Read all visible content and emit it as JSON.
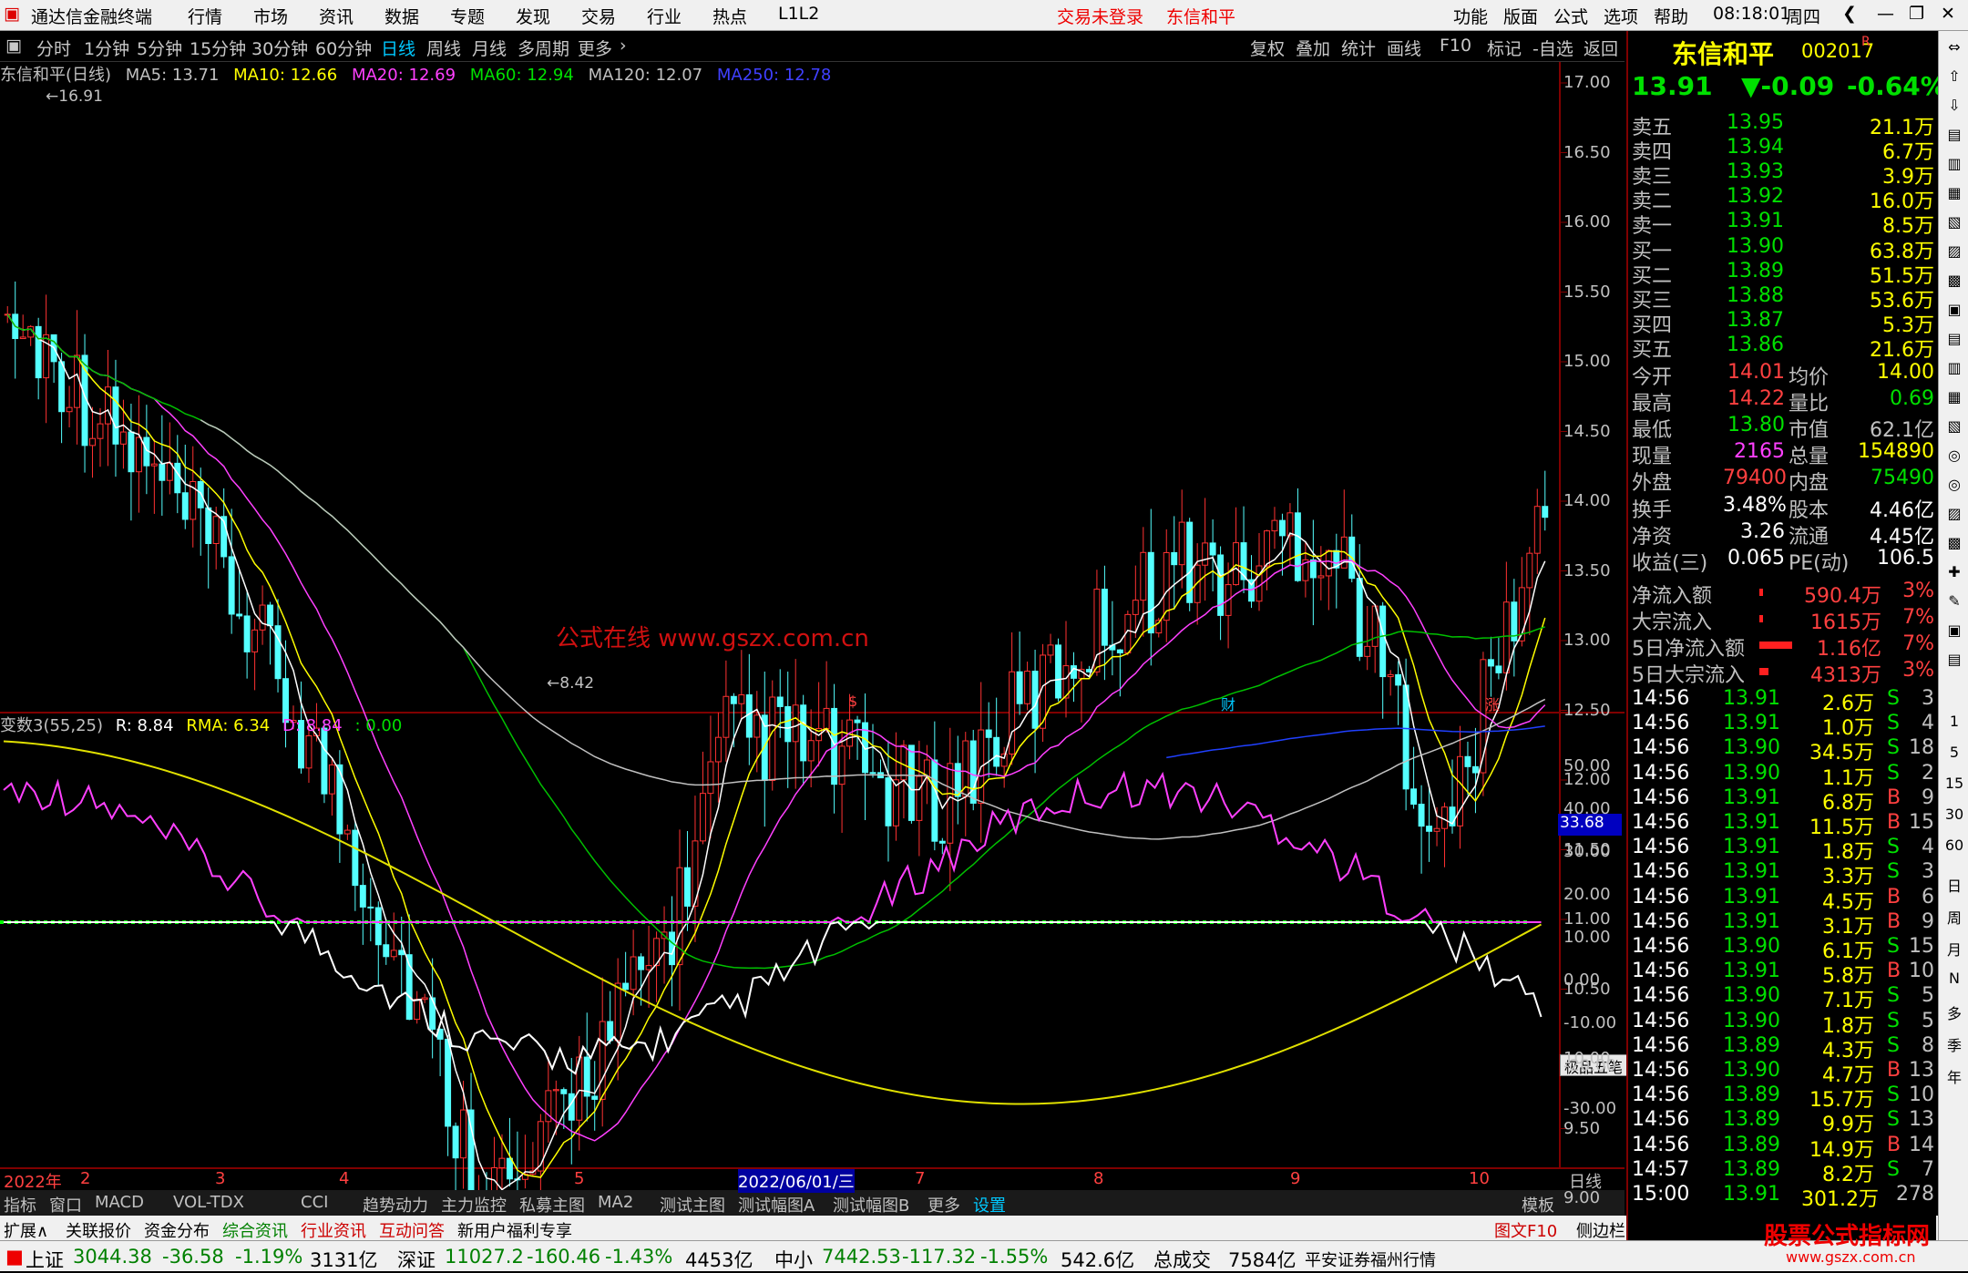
{
  "app": {
    "title": "通达信金融终端",
    "time": "08:18:01",
    "weekday": "周四",
    "login_status": "交易未登录",
    "stock_title": "东信和平"
  },
  "menu": [
    "行情",
    "市场",
    "资讯",
    "数据",
    "专题",
    "发现",
    "交易",
    "行业",
    "热点",
    "L1L2"
  ],
  "right_menu": [
    "功能",
    "版面",
    "公式",
    "选项",
    "帮助"
  ],
  "periods": [
    "分时",
    "1分钟",
    "5分钟",
    "15分钟",
    "30分钟",
    "60分钟",
    "日线",
    "周线",
    "月线",
    "多周期",
    "更多"
  ],
  "tools": [
    "复权",
    "叠加",
    "统计",
    "画线",
    "F10",
    "标记",
    "-自选",
    "返回"
  ],
  "chart": {
    "name": "东信和平(日线)",
    "ma5": "MA5: 13.71",
    "ma10": "MA10: 12.66",
    "ma20": "MA20: 12.69",
    "ma60": "MA60: 12.94",
    "ma120": "MA120: 12.07",
    "ma250": "MA250: 12.78",
    "high_label": "16.91",
    "low_label": "8.42",
    "watermark": "公式在线 www.gszx.com.cn",
    "events": [
      "$",
      "财",
      "涨"
    ]
  },
  "price_axis": [
    "17.00",
    "16.50",
    "16.00",
    "15.50",
    "15.00",
    "14.50",
    "14.00",
    "13.50",
    "13.00",
    "12.50",
    "12.00",
    "11.50",
    "11.00",
    "10.50",
    "10.00",
    "9.50",
    "9.00"
  ],
  "indicator": {
    "name": "变数3(55,25)",
    "r": "R: 8.84",
    "rma": "RMA: 6.34",
    "d": "D: 8.84",
    "zero": ": 0.00",
    "current": "33.68",
    "button": "极品五笔"
  },
  "ind_axis": [
    "50.00",
    "40.00",
    "30.00",
    "20.00",
    "10.00",
    "0.00",
    "-10.00",
    "-20.00",
    "-30.00"
  ],
  "date_axis": [
    "2022年",
    "2",
    "3",
    "4",
    "5",
    "2022/06/01/三",
    "7",
    "8",
    "9",
    "10",
    "日线"
  ],
  "tabs": [
    "指标",
    "窗口",
    "MACD",
    "VOL-TDX",
    "CCI",
    "趋势动力",
    "主力监控",
    "私募主图",
    "MA2",
    "测试主图",
    "测试幅图A",
    "测试幅图B",
    "更多",
    "设置",
    "模板"
  ],
  "tabs2": [
    "扩展∧",
    "关联报价",
    "资金分布",
    "综合资讯",
    "行业资讯",
    "互动问答",
    "新用户福利专享"
  ],
  "tabs2_right": [
    "图文F10",
    "侧边栏 ≪",
    "笔",
    "价",
    "细",
    "势",
    "联",
    "值"
  ],
  "quote": {
    "name": "东信和平",
    "code": "002017",
    "price": "13.91",
    "change": "▼-0.09",
    "pct": "-0.64%",
    "sells": [
      [
        "卖五",
        "13.95",
        "21.1万"
      ],
      [
        "卖四",
        "13.94",
        "6.7万"
      ],
      [
        "卖三",
        "13.93",
        "3.9万"
      ],
      [
        "卖二",
        "13.92",
        "16.0万"
      ],
      [
        "卖一",
        "13.91",
        "8.5万"
      ]
    ],
    "buys": [
      [
        "买一",
        "13.90",
        "63.8万"
      ],
      [
        "买二",
        "13.89",
        "51.5万"
      ],
      [
        "买三",
        "13.88",
        "53.6万"
      ],
      [
        "买四",
        "13.87",
        "5.3万"
      ],
      [
        "买五",
        "13.86",
        "21.6万"
      ]
    ],
    "stats": [
      [
        "今开",
        "14.01",
        "均价",
        "14.00"
      ],
      [
        "最高",
        "14.22",
        "量比",
        "0.69"
      ],
      [
        "最低",
        "13.80",
        "市值",
        "62.1亿"
      ],
      [
        "现量",
        "2165",
        "总量",
        "154890"
      ],
      [
        "外盘",
        "79400",
        "内盘",
        "75490"
      ]
    ],
    "stats2": [
      [
        "换手",
        "3.48%",
        "股本",
        "4.46亿"
      ],
      [
        "净资",
        "3.26",
        "流通",
        "4.45亿"
      ],
      [
        "收益(三)",
        "0.065",
        "PE(动)",
        "106.5"
      ]
    ],
    "flows": [
      [
        "净流入额",
        "590.4万",
        "3%"
      ],
      [
        "大宗流入",
        "1615万",
        "7%"
      ],
      [
        "5日净流入额",
        "1.16亿",
        "7%"
      ],
      [
        "5日大宗流入",
        "4313万",
        "3%"
      ]
    ],
    "ticks": [
      [
        "14:56",
        "13.91",
        "2.6万",
        "S",
        "3"
      ],
      [
        "14:56",
        "13.91",
        "1.0万",
        "S",
        "4"
      ],
      [
        "14:56",
        "13.90",
        "34.5万",
        "S",
        "18"
      ],
      [
        "14:56",
        "13.90",
        "1.1万",
        "S",
        "2"
      ],
      [
        "14:56",
        "13.91",
        "6.8万",
        "B",
        "9"
      ],
      [
        "14:56",
        "13.91",
        "11.5万",
        "B",
        "15"
      ],
      [
        "14:56",
        "13.91",
        "1.8万",
        "S",
        "4"
      ],
      [
        "14:56",
        "13.91",
        "3.3万",
        "S",
        "3"
      ],
      [
        "14:56",
        "13.91",
        "4.5万",
        "B",
        "6"
      ],
      [
        "14:56",
        "13.91",
        "3.1万",
        "B",
        "9"
      ],
      [
        "14:56",
        "13.90",
        "6.1万",
        "S",
        "15"
      ],
      [
        "14:56",
        "13.91",
        "5.8万",
        "B",
        "10"
      ],
      [
        "14:56",
        "13.90",
        "7.1万",
        "S",
        "5"
      ],
      [
        "14:56",
        "13.90",
        "1.8万",
        "S",
        "5"
      ],
      [
        "14:56",
        "13.89",
        "4.3万",
        "S",
        "8"
      ],
      [
        "14:56",
        "13.90",
        "4.7万",
        "B",
        "13"
      ],
      [
        "14:56",
        "13.89",
        "15.7万",
        "S",
        "10"
      ],
      [
        "14:56",
        "13.89",
        "9.9万",
        "S",
        "13"
      ],
      [
        "14:56",
        "13.89",
        "14.9万",
        "B",
        "14"
      ],
      [
        "14:57",
        "13.89",
        "8.2万",
        "S",
        "7"
      ],
      [
        "15:00",
        "13.91",
        "301.2万",
        "",
        "278"
      ]
    ]
  },
  "status": {
    "sh_label": "上证",
    "sh": "3044.38",
    "sh_chg": "-36.58",
    "sh_pct": "-1.19%",
    "sh_amt": "3131亿",
    "sz_label": "深证",
    "sz": "11027.2",
    "sz_chg": "-160.46",
    "sz_pct": "-1.43%",
    "sz_amt": "4453亿",
    "zx_label": "中小",
    "zx": "7442.53",
    "zx_chg": "-117.32",
    "zx_pct": "-1.55%",
    "zx_amt": "542.6亿",
    "total_label": "总成交",
    "total": "7584亿",
    "broker": "平安证券福州行情",
    "logo": "股票公式指标网",
    "logo_url": "www.gszx.com.cn"
  }
}
